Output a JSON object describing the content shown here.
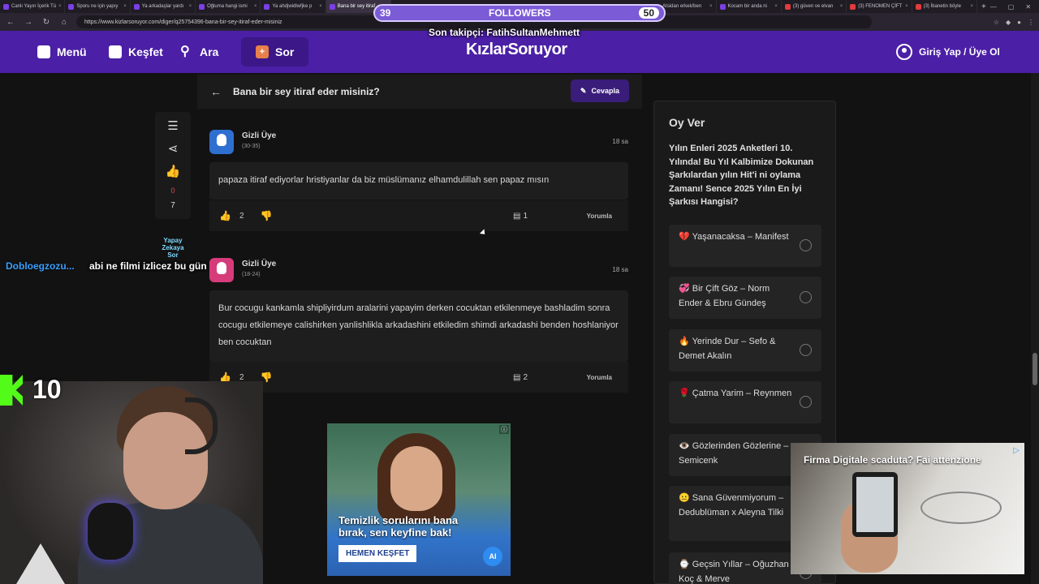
{
  "browser": {
    "tabs": [
      {
        "label": "Canlı Yayın İçerik Tü"
      },
      {
        "label": "Sporu ne için yapıy"
      },
      {
        "label": "Ya arkadaşlar yardı"
      },
      {
        "label": "Oğluma hangi ismi"
      },
      {
        "label": "Ya ahdjwidlwfjke p"
      },
      {
        "label": "Bana bir sey itiraf"
      },
      {
        "label": "Atsidan erkek/ben"
      },
      {
        "label": "Kocam bir anda ni"
      },
      {
        "label": "(3) güven ve elvan"
      },
      {
        "label": "(3) FENOMEN ÇİFT"
      },
      {
        "label": "(3) İbanetin böyle"
      }
    ],
    "new_tab": "+",
    "url": "https://www.kizlarsoruyor.com/diger/q25754396-bana-bir-sey-itiraf-eder-misiniz"
  },
  "overlay": {
    "followers_count": "39",
    "followers_label": "FOLLOWERS",
    "followers_goal": "50",
    "last_follower": "Son takipçi: FatihSultanMehmett",
    "ai_ask": "Yapay Zekaya Sor",
    "chat_user": "Dobloegzozu...",
    "chat_message": "abi ne filmi izlicez bu gün",
    "kick_count": "10"
  },
  "header": {
    "menu": "Menü",
    "explore": "Keşfet",
    "search": "Ara",
    "ask": "Sor",
    "logo": "KızlarSoruyor",
    "login": "Giriş Yap / Üye Ol"
  },
  "question": {
    "title": "Bana bir sey itiraf eder misiniz?",
    "answer_button": "Cevapla",
    "like_count": "0",
    "view_count": "7"
  },
  "answers": [
    {
      "user": "Gizli Üye",
      "age": "(30-35)",
      "time": "18 sa",
      "text": "papaza itiraf ediyorlar hristiyanlar da biz müslümanız elhamdulillah sen papaz mısın",
      "likes": "2",
      "comments": "1",
      "comment_button": "Yorumla"
    },
    {
      "user": "Gizli Üye",
      "age": "(18-24)",
      "time": "18 sa",
      "text": "Bur cocugu kankamla shipliyirdum aralarini yapayim derken cocuktan etkilenmeye bashladim sonra cocugu etkilemeye calishirken yanlishlikla arkadashini etkiledim shimdi arkadashi benden hoshlaniyor ben cocuktan",
      "likes": "2",
      "comments": "2",
      "comment_button": "Yorumla"
    }
  ],
  "ad": {
    "headline": "Temizlik sorularını bana bırak, sen keyfine bak!",
    "cta": "HEMEN KEŞFET",
    "badge": "AI"
  },
  "poll": {
    "title": "Oy Ver",
    "question": "Yılın Enleri 2025 Anketleri 10. Yılında! Bu Yıl Kalbimize Dokunan Şarkılardan yılın Hit'i ni oylama Zamanı! Sence 2025 Yılın En İyi Şarkısı Hangisi?",
    "options": [
      {
        "emoji": "💔",
        "label": "Yaşanacaksa – Manifest"
      },
      {
        "emoji": "💞",
        "label": "Bir Çift Göz – Norm Ender & Ebru Gündeş"
      },
      {
        "emoji": "🔥",
        "label": "Yerinde Dur – Sefo & Demet Akalın"
      },
      {
        "emoji": "🌹",
        "label": "Çatma Yarim – Reynmen"
      },
      {
        "emoji": "👁️",
        "label": "Gözlerinden Gözlerine – Semicenk"
      },
      {
        "emoji": "😐",
        "label": "Sana Güvenmiyorum – Dedublüman x Aleyna Tilki"
      },
      {
        "emoji": "⌚",
        "label": "Geçsin Yıllar – Oğuzhan Koç & Merve"
      }
    ]
  },
  "video_ad": {
    "title": "Firma Digitale scaduta? Fai attenzione"
  },
  "colors": {
    "brand": "#4b1fa6",
    "like_zero": "#e24c4c",
    "kick_green": "#53fc18"
  }
}
